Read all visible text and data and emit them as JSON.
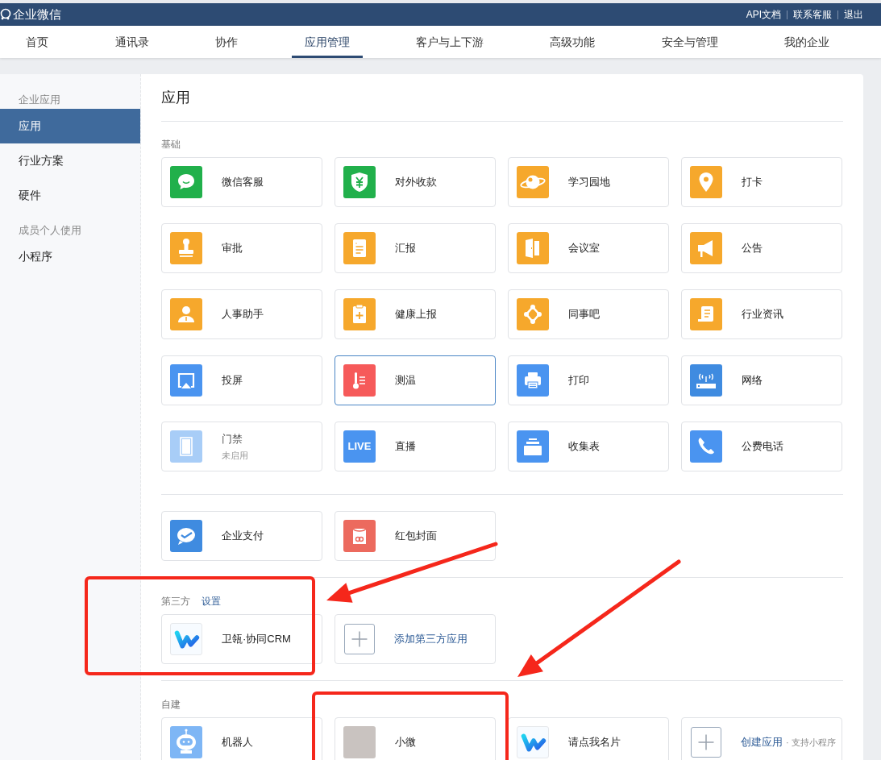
{
  "header": {
    "logo": "企业微信",
    "links": [
      "API文档",
      "联系客服",
      "退出"
    ]
  },
  "nav": [
    {
      "label": "首页",
      "selected": false
    },
    {
      "label": "通讯录",
      "selected": false
    },
    {
      "label": "协作",
      "selected": false
    },
    {
      "label": "应用管理",
      "selected": true
    },
    {
      "label": "客户与上下游",
      "selected": false
    },
    {
      "label": "高级功能",
      "selected": false
    },
    {
      "label": "安全与管理",
      "selected": false
    },
    {
      "label": "我的企业",
      "selected": false
    }
  ],
  "sidebar": [
    {
      "header": "企业应用",
      "items": [
        {
          "label": "应用",
          "selected": true
        },
        {
          "label": "行业方案",
          "selected": false
        },
        {
          "label": "硬件",
          "selected": false
        }
      ]
    },
    {
      "header": "成员个人使用",
      "items": [
        {
          "label": "小程序",
          "selected": false
        }
      ]
    }
  ],
  "page_title": "应用",
  "sections": [
    {
      "label": "基础",
      "apps": [
        {
          "kind": "app",
          "name": "微信客服",
          "color": "#21b04b",
          "selected": false,
          "disabled": false
        },
        {
          "kind": "app",
          "name": "对外收款",
          "color": "#21b04b",
          "selected": false,
          "disabled": false
        },
        {
          "kind": "app",
          "name": "学习园地",
          "color": "#f6a82c",
          "selected": false,
          "disabled": false
        },
        {
          "kind": "app",
          "name": "打卡",
          "color": "#f6a82c",
          "selected": false,
          "disabled": false
        },
        {
          "kind": "app",
          "name": "审批",
          "color": "#f6a82c",
          "selected": false,
          "disabled": false
        },
        {
          "kind": "app",
          "name": "汇报",
          "color": "#f6a82c",
          "selected": false,
          "disabled": false
        },
        {
          "kind": "app",
          "name": "会议室",
          "color": "#f6a82c",
          "selected": false,
          "disabled": false
        },
        {
          "kind": "app",
          "name": "公告",
          "color": "#f6a82c",
          "selected": false,
          "disabled": false
        },
        {
          "kind": "app",
          "name": "人事助手",
          "color": "#f6a82c",
          "selected": false,
          "disabled": false
        },
        {
          "kind": "app",
          "name": "健康上报",
          "color": "#f6a82c",
          "selected": false,
          "disabled": false
        },
        {
          "kind": "app",
          "name": "同事吧",
          "color": "#f6a82c",
          "selected": false,
          "disabled": false
        },
        {
          "kind": "app",
          "name": "行业资讯",
          "color": "#f6a82c",
          "selected": false,
          "disabled": false
        },
        {
          "kind": "app",
          "name": "投屏",
          "color": "#4a94f0",
          "selected": false,
          "disabled": false
        },
        {
          "kind": "app",
          "name": "测温",
          "color": "#f65a5a",
          "selected": true,
          "disabled": false
        },
        {
          "kind": "app",
          "name": "打印",
          "color": "#4a94f0",
          "selected": false,
          "disabled": false
        },
        {
          "kind": "app",
          "name": "网络",
          "color": "#3f8be0",
          "selected": false,
          "disabled": false
        },
        {
          "kind": "app",
          "name": "门禁",
          "color": "#a8cdf7",
          "selected": false,
          "disabled": true,
          "subtitle": "未启用"
        },
        {
          "kind": "app",
          "name": "直播",
          "color": "#4a94f0",
          "selected": false,
          "disabled": false,
          "icon_text": "LIVE"
        },
        {
          "kind": "app",
          "name": "收集表",
          "color": "#4a94f0",
          "selected": false,
          "disabled": false
        },
        {
          "kind": "app",
          "name": "公费电话",
          "color": "#4a94f0",
          "selected": false,
          "disabled": false
        }
      ]
    },
    {
      "apps": [
        {
          "kind": "app",
          "name": "企业支付",
          "color": "#3f8be0",
          "selected": false,
          "disabled": false
        },
        {
          "kind": "app",
          "name": "红包封面",
          "color": "#ec6a5e",
          "selected": false,
          "disabled": false
        }
      ]
    },
    {
      "label": "第三方",
      "link": "设置",
      "apps": [
        {
          "kind": "logo",
          "name": "卫瓴·协同CRM",
          "selected": false,
          "disabled": false
        },
        {
          "kind": "add",
          "name": "添加第三方应用",
          "selected": false,
          "disabled": false
        }
      ]
    },
    {
      "label": "自建",
      "apps": [
        {
          "kind": "robot",
          "name": "机器人",
          "selected": false,
          "disabled": false
        },
        {
          "kind": "photo",
          "name": "小微",
          "selected": false,
          "disabled": false
        },
        {
          "kind": "logo",
          "name": "请点我名片",
          "selected": false,
          "disabled": false
        },
        {
          "kind": "add",
          "name": "创建应用",
          "note": "· 支持小程序",
          "selected": false,
          "disabled": false
        }
      ]
    }
  ],
  "annotations": [
    {
      "kind": "box"
    },
    {
      "kind": "box"
    },
    {
      "kind": "arrow"
    },
    {
      "kind": "arrow"
    }
  ]
}
